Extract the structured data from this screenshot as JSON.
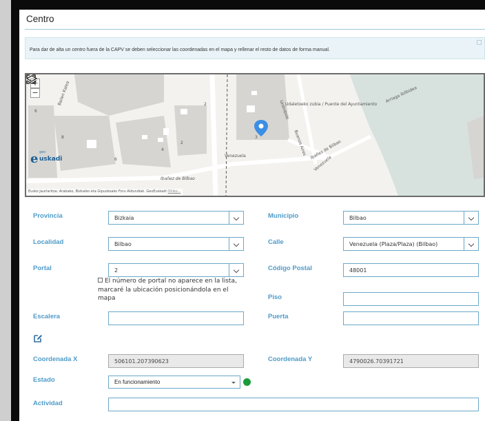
{
  "section": {
    "title": "Centro",
    "info_text": "Para dar de alta un centro fuera de la CAPV se deben seleccionar las coordenadas en el mapa y rellenar el resto de datos de forma manual."
  },
  "map": {
    "zoom_in": "+",
    "zoom_out": "−",
    "logo_small": "geo",
    "logo_e": "e",
    "logo_name": "uskadi",
    "attribution": "Eusko Jaurlaritza; Arabako, Bizkaiko eta Gipuzkoako Foru Aldundiak. GeoEuskadi",
    "attribution_link": "Ohiko...",
    "street_labels": {
      "bailen": "Bailen Kalea",
      "udaletxeko": "Udaletxeko zubia / Puente del Ayuntamiento",
      "urdinbide": "Urdinbide",
      "arriaga": "Arriaga ibilbidea",
      "venezuela": "Venezuela",
      "ibanez": "Ibañez de Bilbao",
      "ibanez2": "Ibañez de Bilbao",
      "buenos_aires": "Buenos Aires",
      "venezuela2": "Venezuela",
      "bailen2": "Bailen",
      "num6": "6",
      "num8": "8",
      "num4": "4",
      "num2": "2",
      "num2b": "2",
      "num6b": "6",
      "num3": "3"
    },
    "marker_color": "#3a8ee6"
  },
  "form": {
    "provincia": {
      "label": "Provincia",
      "value": "Bizkaia"
    },
    "municipio": {
      "label": "Municipio",
      "value": "Bilbao"
    },
    "localidad": {
      "label": "Localidad",
      "value": "Bilbao"
    },
    "calle": {
      "label": "Calle",
      "value": "Venezuela (Plaza/Plaza) (Bilbao)"
    },
    "portal": {
      "label": "Portal",
      "value": "2"
    },
    "portal_hint": "El número de portal no aparece en la lista, marcaré la ubicación posicionándola en el mapa",
    "codigo_postal": {
      "label": "Código Postal",
      "value": "48001"
    },
    "piso": {
      "label": "Piso",
      "value": ""
    },
    "escalera": {
      "label": "Escalera",
      "value": ""
    },
    "puerta": {
      "label": "Puerta",
      "value": ""
    },
    "coordenada_x": {
      "label": "Coordenada X",
      "value": "506101.207390623"
    },
    "coordenada_y": {
      "label": "Coordenada Y",
      "value": "4790026.70391721"
    },
    "estado": {
      "label": "Estado",
      "value": "En funcionamiento",
      "status_color": "#1a9c3a"
    },
    "actividad": {
      "label": "Actividad",
      "value": ""
    }
  },
  "colors": {
    "label": "#4f9bc8",
    "field_border": "#6aa8c8",
    "river": "#d7e2de"
  }
}
